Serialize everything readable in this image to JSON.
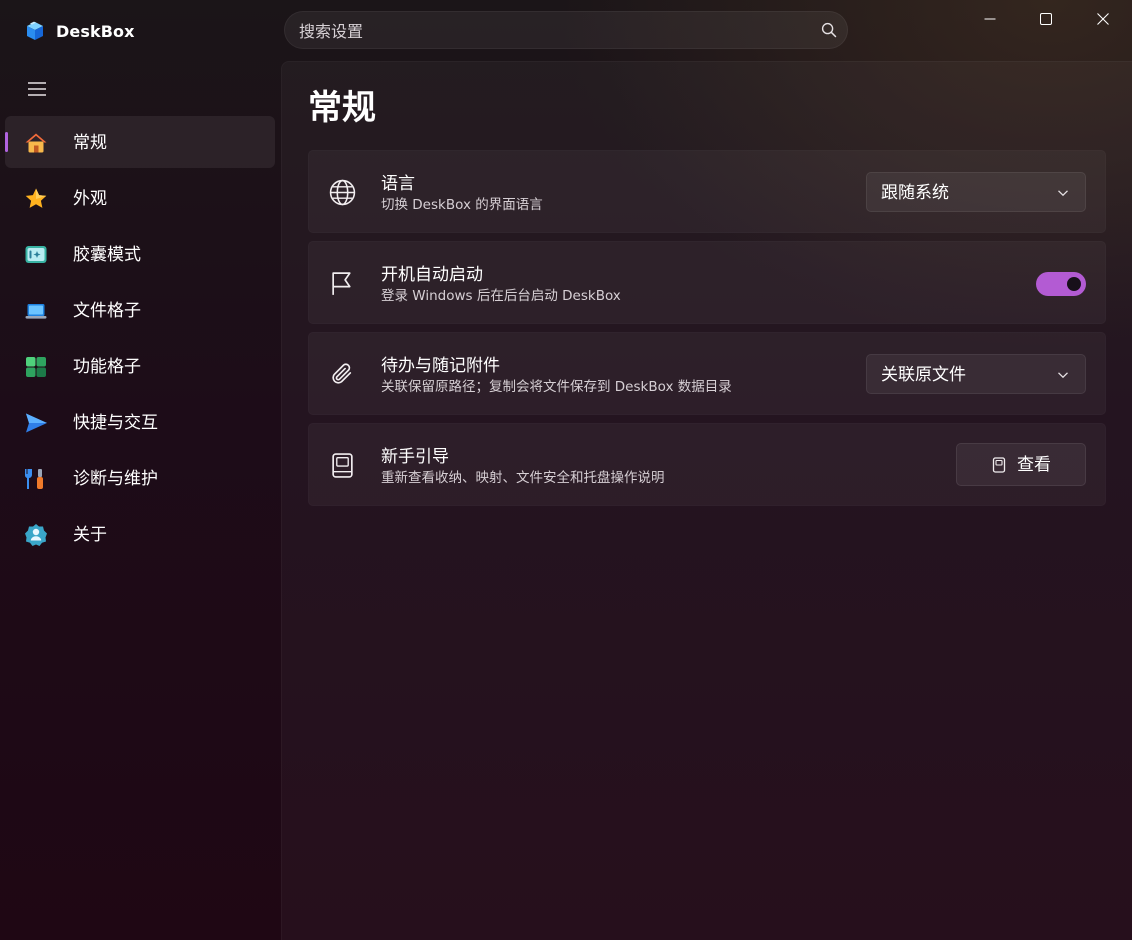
{
  "app": {
    "title": "DeskBox",
    "logo_icon": "deskbox-cube-logo",
    "accent_color": "#b163e0"
  },
  "search": {
    "placeholder": "搜索设置",
    "value": "",
    "icon": "search-icon"
  },
  "window_controls": [
    "minimize",
    "maximize",
    "close"
  ],
  "sidebar": {
    "menu_icon": "hamburger-menu-icon",
    "items": [
      {
        "label": "常规",
        "icon": "home-icon",
        "active": true
      },
      {
        "label": "外观",
        "icon": "star-icon",
        "active": false
      },
      {
        "label": "胶囊模式",
        "icon": "capsule-icon",
        "active": false
      },
      {
        "label": "文件格子",
        "icon": "laptop-icon",
        "active": false
      },
      {
        "label": "功能格子",
        "icon": "grid-tiles-icon",
        "active": false
      },
      {
        "label": "快捷与交互",
        "icon": "send-arrow-icon",
        "active": false
      },
      {
        "label": "诊断与维护",
        "icon": "tools-icon",
        "active": false
      },
      {
        "label": "关于",
        "icon": "info-badge-icon",
        "active": false
      }
    ]
  },
  "main": {
    "title": "常规",
    "settings": [
      {
        "title": "语言",
        "description": "切换 DeskBox 的界面语言",
        "icon": "globe-icon",
        "control": "dropdown",
        "value": "跟随系统"
      },
      {
        "title": "开机自动启动",
        "description": "登录 Windows 后在后台启动 DeskBox",
        "icon": "flag-icon",
        "control": "toggle",
        "checked": true
      },
      {
        "title": "待办与随记附件",
        "description": "关联保留原路径；复制会将文件保存到 DeskBox 数据目录",
        "icon": "paperclip-icon",
        "control": "dropdown",
        "value": "关联原文件"
      },
      {
        "title": "新手引导",
        "description": "重新查看收纳、映射、文件安全和托盘操作说明",
        "icon": "book-icon",
        "control": "button",
        "button_label": "查看",
        "button_icon": "guide-book-icon"
      }
    ]
  }
}
